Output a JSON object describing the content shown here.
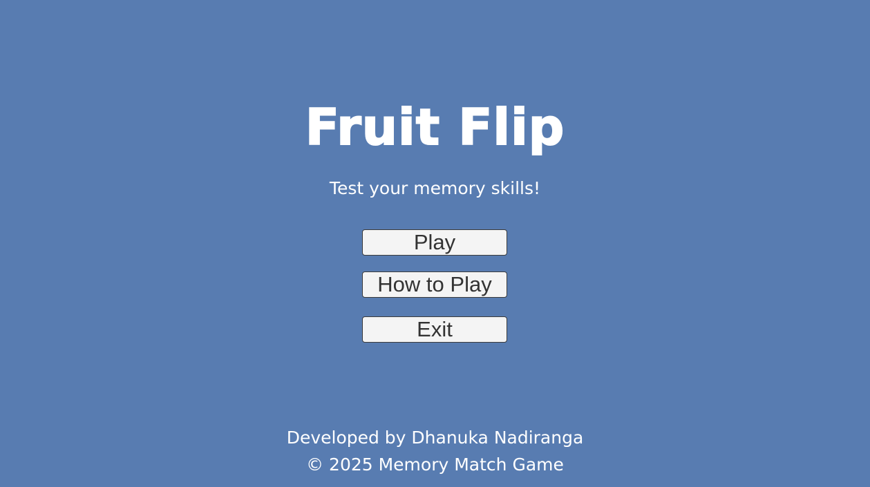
{
  "game": {
    "title": "Fruit Flip",
    "tagline": "Test your memory skills!"
  },
  "menu": {
    "play_label": "Play",
    "how_to_play_label": "How to Play",
    "exit_label": "Exit"
  },
  "footer": {
    "credit": "Developed by Dhanuka Nadiranga",
    "copyright": "© 2025 Memory Match Game"
  },
  "colors": {
    "background": "#587cb1",
    "text": "#ffffff",
    "button_background": "#f4f4f4",
    "button_text": "#333333"
  }
}
